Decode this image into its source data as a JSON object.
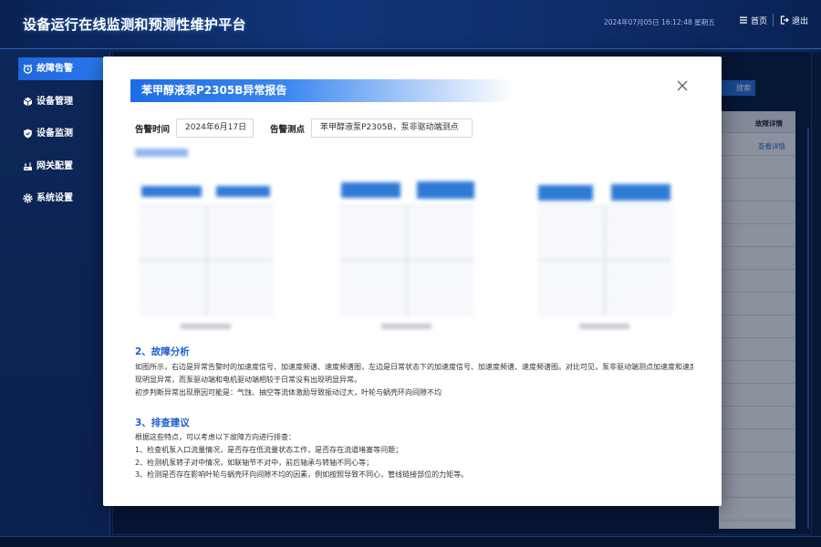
{
  "app": {
    "title": "设备运行在线监测和预测性维护平台"
  },
  "header": {
    "datetime": "2024年07月05日 16:12:48 星期五",
    "home_label": "首页",
    "home_icon": "menu-icon",
    "logout_label": "退出",
    "logout_icon": "logout-icon"
  },
  "sidebar": {
    "items": [
      {
        "label": "故障告警",
        "icon": "alarm-icon",
        "active": true
      },
      {
        "label": "设备管理",
        "icon": "cube-icon",
        "active": false
      },
      {
        "label": "设备监测",
        "icon": "shield-icon",
        "active": false
      },
      {
        "label": "网关配置",
        "icon": "router-icon",
        "active": false
      },
      {
        "label": "系统设置",
        "icon": "gear-icon",
        "active": false
      }
    ]
  },
  "main": {
    "search_button_label": "搜索",
    "table": {
      "header": "故障详情",
      "rows": [
        "查看详情"
      ]
    }
  },
  "modal": {
    "title": "苯甲醇液泵P2305B异常报告",
    "close_icon": "close-icon",
    "alarm_time_label": "告警时间",
    "alarm_time_value": "2024年6月17日",
    "alarm_point_label": "告警测点",
    "alarm_point_value": "苯甲醇液泵P2305B，泵非驱动端测点",
    "analysis": {
      "heading": "2、故障分析",
      "lines": [
        "如图所示，右边是异常告警时的加速度信号、加速度频谱、速度频谱图，左边是日常状态下的加速度信号、加速度频谱、速度频谱图。对比可见，泵非驱动端测点加速度和速度出",
        "现明显异常，而泵驱动端和电机驱动端相较于日常没有出现明显异常。",
        "初步判断异常出现原因可能是：气蚀、抽空等流体激励导致振动过大，叶轮与蜗壳环向间隙不均"
      ]
    },
    "suggestions": {
      "heading": "3、排查建议",
      "lines": [
        "根据这些特点，可以考虑以下故障方向进行排查：",
        "1、检查机泵入口流量情况，是否存在低流量状态工作，是否存在流道堵塞等问题；",
        "2、检测机泵转子对中情况，如联轴节不对中，前后轴承与转轴不同心等；",
        "3、检测是否存在影响叶轮与蜗壳环向间隙不均的因素，例如按照导致不同心，管线链接部位的力矩等。"
      ]
    }
  },
  "colors": {
    "header_bg": "#0a2255",
    "sidebar_active": "#1f66dc",
    "modal_title_bar": "#1c6de6",
    "section_heading": "#1f5fcf",
    "link": "#2a6fd6"
  }
}
